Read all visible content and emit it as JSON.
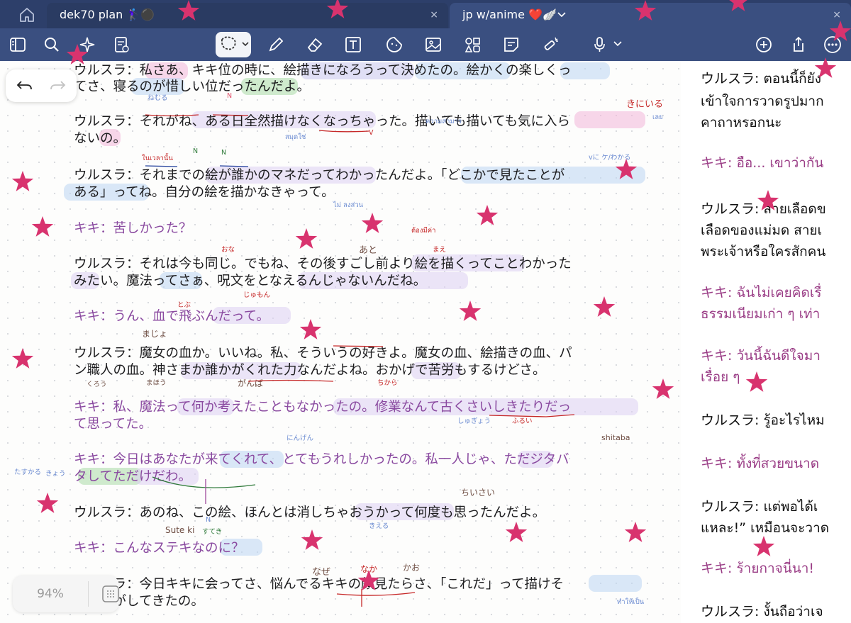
{
  "tabs": [
    {
      "title": "dek70 plan 🏌🏻‍♀️⚫️",
      "close": "×"
    },
    {
      "title": "jp w/anime ❤️🪽",
      "close": "×"
    }
  ],
  "toolbar": {
    "icons": [
      "sidebar-icon",
      "search-icon",
      "sparkle-icon",
      "page-edit-icon",
      "lasso-select-icon",
      "pen-icon",
      "eraser-icon",
      "text-box-icon",
      "sticker-icon",
      "image-icon",
      "shapes-icon",
      "sticky-note-icon",
      "laser-pointer-icon",
      "microphone-icon",
      "add-page-icon",
      "share-icon",
      "more-icon"
    ]
  },
  "zoom": "94%",
  "lines": [
    {
      "t": "ウルスラ：私さあ、キキ位の時に、絵描きになろうって決めたの。絵かくの楽しくっ",
      "k": false
    },
    {
      "t": "てさ、寝るのが惜しい位だったんだよ。",
      "k": false
    },
    {
      "t": "ウルスラ：それがね、ある日全然描けなくなっちゃった。描いても描いても気に入ら",
      "k": false
    },
    {
      "t": "ないの。",
      "k": false
    },
    {
      "t": "ウルスラ：それまでの絵が誰かのマネだってわかったんだよ。「どこかで見たことが",
      "k": false
    },
    {
      "t": "ある」ってね。自分の絵を描かなきゃって。",
      "k": false
    },
    {
      "t": "キキ：苦しかった？",
      "k": true
    },
    {
      "t": "ウルスラ：それは今も同じ。でもね、その後すごし前より絵を描くってことわかった",
      "k": false
    },
    {
      "t": "みたい。魔法ってさぁ、呪文をとなえるんじゃないんだね。",
      "k": false
    },
    {
      "t": "キキ：うん、血で飛ぶんだって。",
      "k": true
    },
    {
      "t": "ウルスラ：魔女の血か。いいね。私、そういうの好きよ。魔女の血、絵描きの血、パ",
      "k": false
    },
    {
      "t": "ン職人の血。神さまか誰かがくれた力なんだよね。おかげで苦労もするけどさ。",
      "k": false
    },
    {
      "t": "キキ：私、魔法って何か考えたこともなかったの。修業なんて古くさいしきたりだっ",
      "k": true
    },
    {
      "t": "て思ってた。",
      "k": true
    },
    {
      "t": "キキ：今日はあなたが来てくれて、とてもうれしかったの。私一人じゃ、ただジタバ",
      "k": true
    },
    {
      "t": "タしてただけだわ。",
      "k": true
    },
    {
      "t": "ウルスラ：あのね、この絵、ほんとは消しちゃおうかって何度も思ったんだよ。",
      "k": false
    },
    {
      "t": "キキ：こんなステキなのに？",
      "k": true
    },
    {
      "t": "ウルスラ：今日キキに会ってさ、悩んでるキキの顔見たらさ、「これだ」って描けそ",
      "k": false
    },
    {
      "t": "うな気がしてきたの。",
      "k": false
    }
  ],
  "thai": [
    {
      "t": "ウルスラ: ตอนนี้ก็ยัง",
      "k": false
    },
    {
      "t": "เข้าใจการวาดรูปมาก",
      "k": false
    },
    {
      "t": "คาถาหรอกนะ",
      "k": false
    },
    {
      "t": "キキ: อือ... เขาว่ากัน",
      "k": true
    },
    {
      "t": "ウルスラ: สายเลือดข",
      "k": false
    },
    {
      "t": "เลือดของแม่มด สายเ",
      "k": false
    },
    {
      "t": "พระเจ้าหรือใครสักคน",
      "k": false
    },
    {
      "t": "キキ: ฉันไม่เคยคิดเรื่",
      "k": true
    },
    {
      "t": "ธรรมเนียมเก่า ๆ เท่า",
      "k": true
    },
    {
      "t": "キキ: วันนี้ฉันดีใจมา",
      "k": true
    },
    {
      "t": "เรื่อย ๆ",
      "k": true
    },
    {
      "t": "ウルスラ: รู้อะไรไหม",
      "k": false
    },
    {
      "t": "キキ: ทั้งที่สวยขนาด",
      "k": true
    },
    {
      "t": "ウルスラ: แต่พอได้เ",
      "k": false
    },
    {
      "t": "แหละ!” เหมือนจะวาด",
      "k": false
    },
    {
      "t": "キキ: ร้ายกาจนี่นา!",
      "k": true
    },
    {
      "t": "ウルスラ: งั้นถือว่าเจ",
      "k": false
    }
  ],
  "annotations": [
    "ねむる",
    "N",
    "N",
    "N",
    "V",
    "สมุดใช่",
    "ไม่ ลงส่วน",
    "きにいる",
    "ความสามาร",
    "おな",
    "あと",
    "まえ",
    "じゅもん",
    "とぶ",
    "まじょ",
    "ちから",
    "くろう",
    "しゅぎょう",
    "ふるい",
    "shitaba",
    "たすかる",
    "きょう",
    "なぜ",
    "なか",
    "かお",
    "ちいさい",
    "すてき",
    "きえる",
    "Sute ki",
    "N",
    "がんば",
    "まほう",
    "にんげん",
    "ต้องมีค่า",
    "ในเวลานั้น",
    "vに ケ/わかる",
    "เลย",
    "ทำให้เป็น"
  ]
}
